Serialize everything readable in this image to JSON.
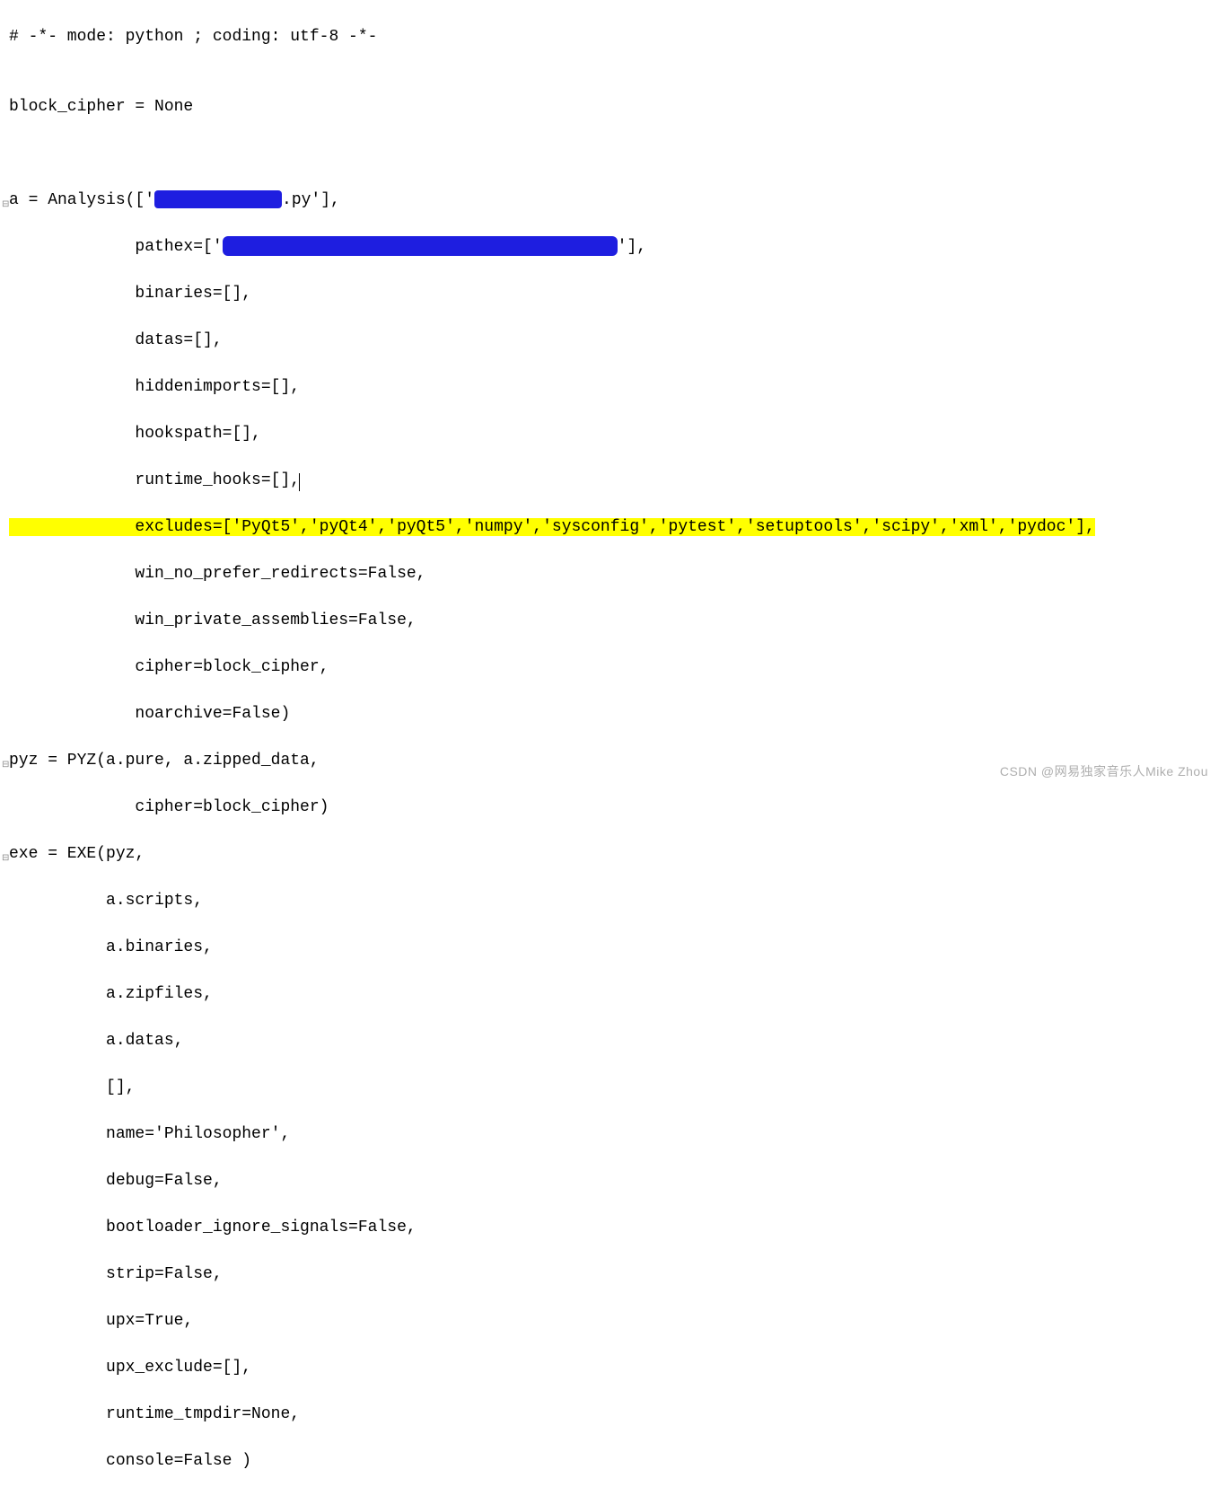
{
  "lines": {
    "l1": "# -*- mode: python ; coding: utf-8 -*-",
    "l2": "",
    "l3": "block_cipher = None",
    "l4": "",
    "l5": "",
    "l6_pre": "a = Analysis(['",
    "l6_post": ".py'],",
    "l7_pre": "             pathex=['",
    "l7_post": "'],",
    "l8": "             binaries=[],",
    "l9": "             datas=[],",
    "l10": "             hiddenimports=[],",
    "l11": "             hookspath=[],",
    "l12": "             runtime_hooks=[],",
    "l13_hl": "             excludes=['PyQt5','pyQt4','pyQt5','numpy','sysconfig','pytest','setuptools','scipy','xml','pydoc'],",
    "l14": "             win_no_prefer_redirects=False,",
    "l15": "             win_private_assemblies=False,",
    "l16": "             cipher=block_cipher,",
    "l17": "             noarchive=False)",
    "l18": "pyz = PYZ(a.pure, a.zipped_data,",
    "l19": "             cipher=block_cipher)",
    "l20": "exe = EXE(pyz,",
    "l21": "          a.scripts,",
    "l22": "          a.binaries,",
    "l23": "          a.zipfiles,",
    "l24": "          a.datas,",
    "l25": "          [],",
    "l26": "          name='Philosopher',",
    "l27": "          debug=False,",
    "l28": "          bootloader_ignore_signals=False,",
    "l29": "          strip=False,",
    "l30": "          upx=True,",
    "l31": "          upx_exclude=[],",
    "l32": "          runtime_tmpdir=None,",
    "l33": "          console=False )"
  },
  "excludes_list": [
    "PyQt5",
    "pyQt4",
    "pyQt5",
    "numpy",
    "sysconfig",
    "pytest",
    "setuptools",
    "scipy",
    "xml",
    "pydoc"
  ],
  "watermark": "CSDN @网易独家音乐人Mike Zhou"
}
